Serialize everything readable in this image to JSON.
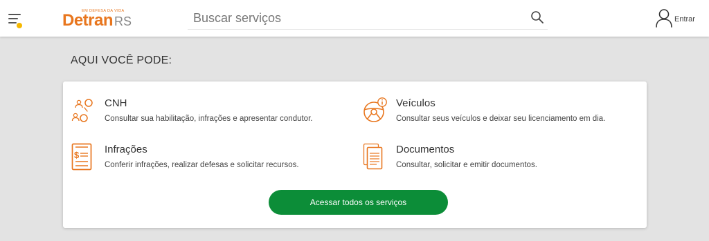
{
  "header": {
    "logo": {
      "tagline": "EM DEFESA DA VIDA",
      "name": "Detran",
      "suffix": "RS"
    },
    "search": {
      "placeholder": "Buscar serviços",
      "value": ""
    },
    "login_label": "Entrar"
  },
  "section": {
    "title": "AQUI VOCÊ PODE:",
    "services": [
      {
        "title": "CNH",
        "description": "Consultar sua habilitação, infrações e apresentar condutor.",
        "icon": "people-exchange-icon"
      },
      {
        "title": "Veículos",
        "description": "Consultar seus veículos e deixar seu licenciamento em dia.",
        "icon": "steering-wheel-info-icon"
      },
      {
        "title": "Infrações",
        "description": "Conferir infrações, realizar defesas e solicitar recursos.",
        "icon": "fine-document-icon"
      },
      {
        "title": "Documentos",
        "description": "Consultar, solicitar e emitir documentos.",
        "icon": "documents-icon"
      }
    ],
    "cta_label": "Acessar todos os serviços"
  },
  "colors": {
    "accent": "#e8761e",
    "primary_button": "#0c8d38",
    "notification_dot": "#f6b800"
  }
}
